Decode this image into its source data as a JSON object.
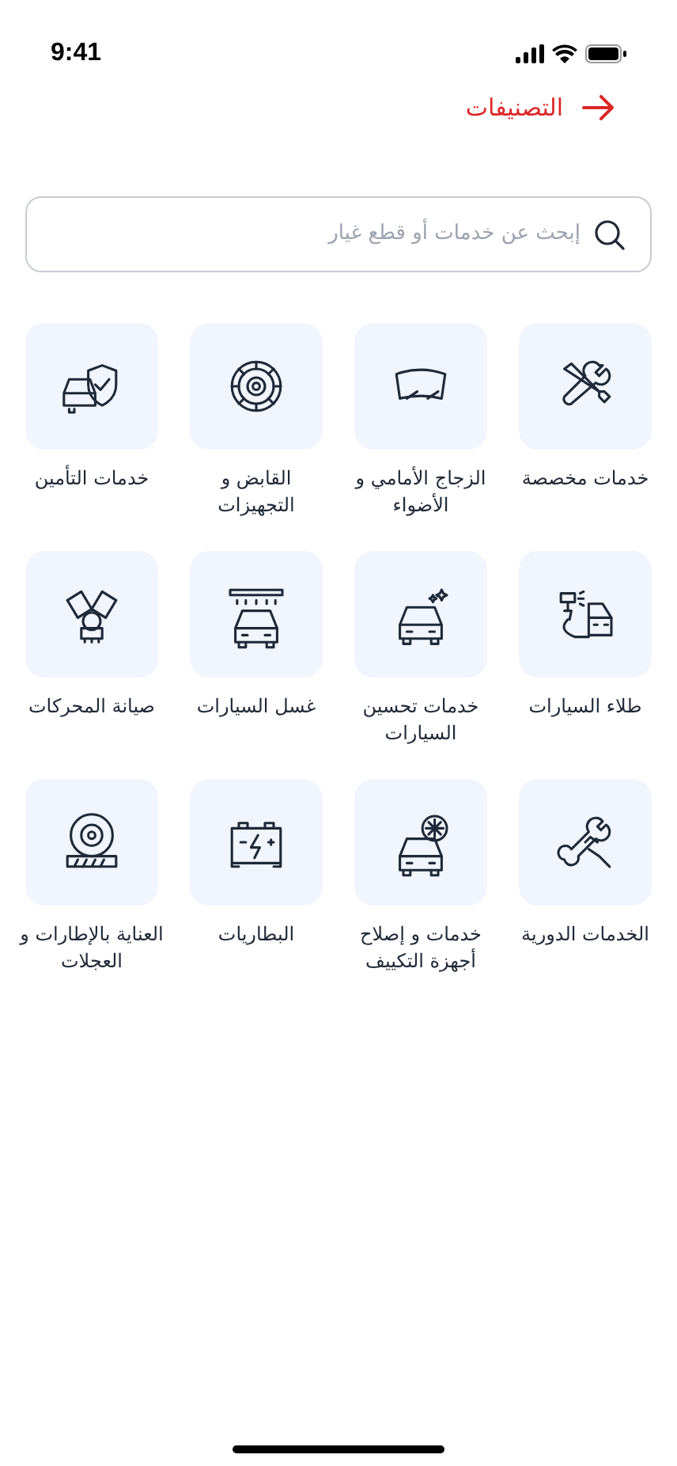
{
  "status_bar": {
    "time": "9:41"
  },
  "header": {
    "title": "التصنيفات"
  },
  "search": {
    "placeholder": "إبحث عن خدمات أو قطع غيار"
  },
  "categories": [
    {
      "label": "خدمات مخصصة"
    },
    {
      "label": "الزجاج الأمامي و الأضواء"
    },
    {
      "label": "القابض و التجهيزات"
    },
    {
      "label": "خدمات التأمين"
    },
    {
      "label": "طلاء السيارات"
    },
    {
      "label": "خدمات تحسين السيارات"
    },
    {
      "label": "غسل السيارات"
    },
    {
      "label": "صيانة المحركات"
    },
    {
      "label": "الخدمات الدورية"
    },
    {
      "label": "خدمات و إصلاح أجهزة التكييف"
    },
    {
      "label": "البطاريات"
    },
    {
      "label": "العناية بالإطارات و العجلات"
    }
  ]
}
